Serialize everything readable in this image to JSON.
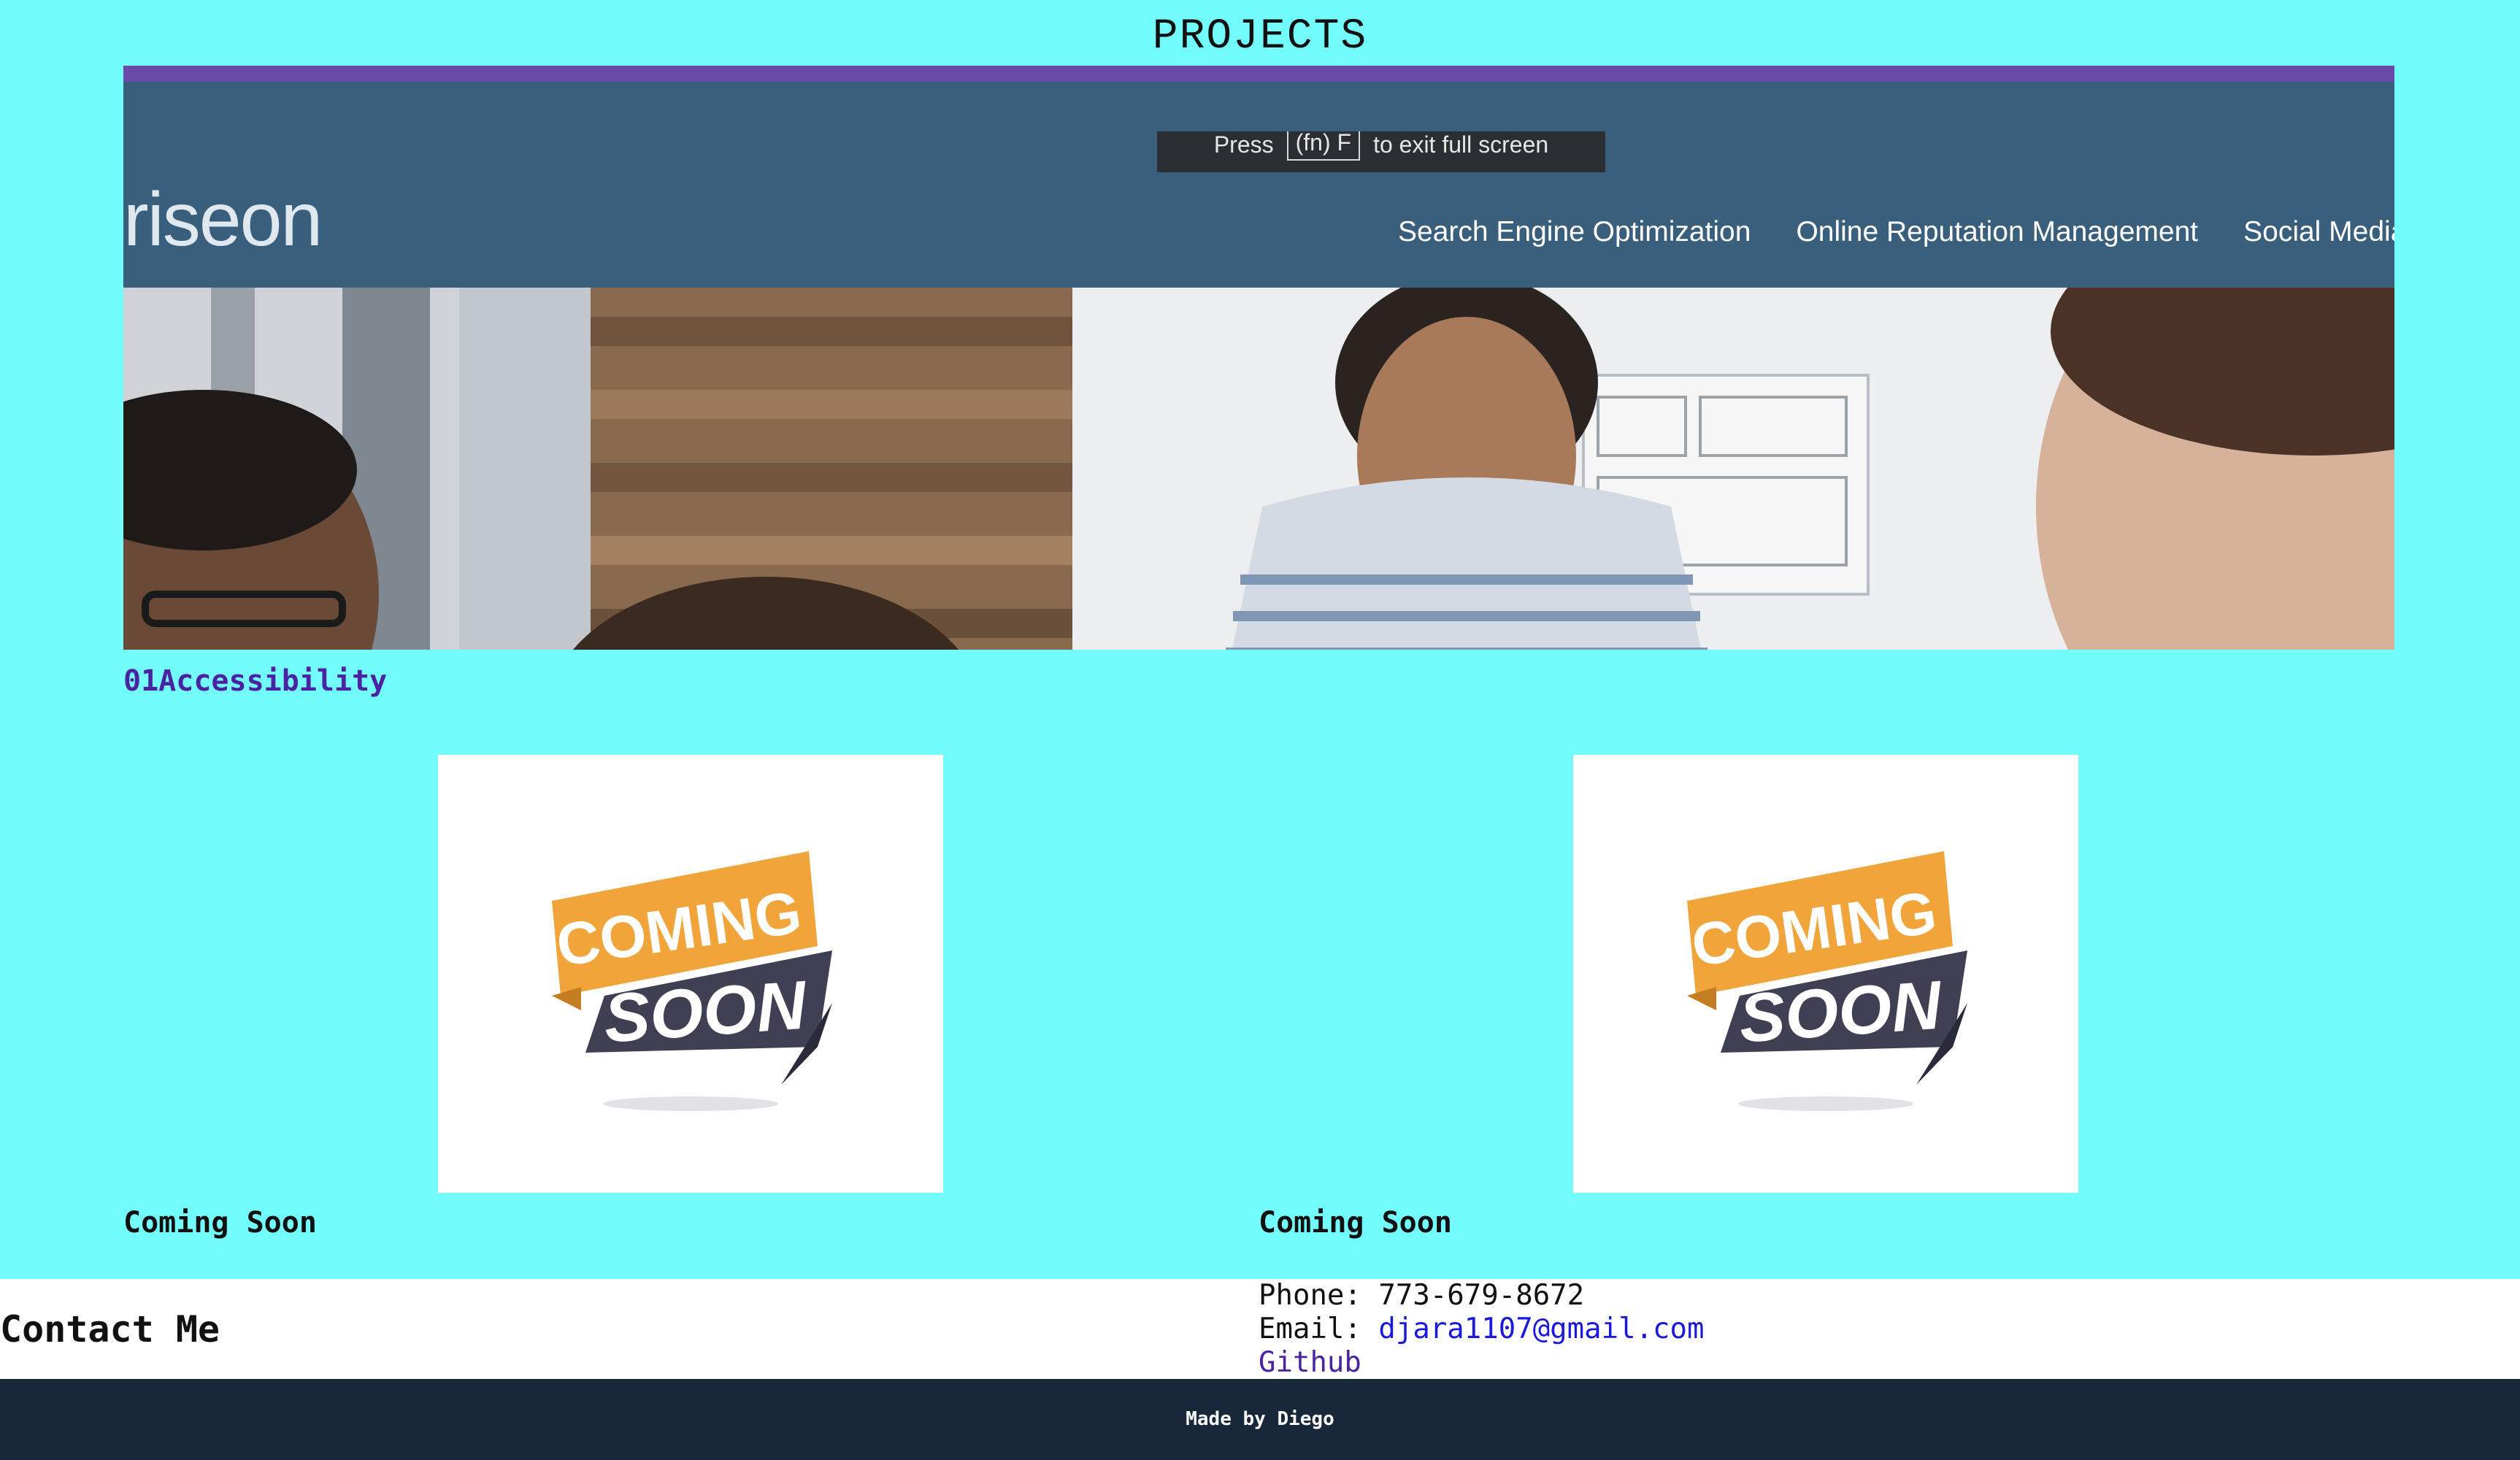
{
  "page": {
    "title": "PROJECTS"
  },
  "screenshot": {
    "logo": "riseon",
    "fullscreen_tip": {
      "before": "Press",
      "key": "(fn) F",
      "after": "to exit full screen"
    },
    "nav_links": [
      "Search Engine Optimization",
      "Online Reputation Management",
      "Social Media Mark"
    ]
  },
  "section": {
    "label": "01Accessibility"
  },
  "cards": [
    {
      "badge_top": "COMING",
      "badge_bottom": "SOON",
      "caption": "Coming Soon"
    },
    {
      "badge_top": "COMING",
      "badge_bottom": "SOON",
      "caption": "Coming Soon"
    }
  ],
  "contact": {
    "title": "Contact Me",
    "phone_label": "Phone:",
    "phone": "773-679-8672",
    "email_label": "Email:",
    "email": "djara1107@gmail.com",
    "github": "Github"
  },
  "footer": {
    "text": "Made by Diego"
  },
  "colors": {
    "background": "#73fcfc",
    "nav": "#3a5f7d",
    "accent_orange": "#f0a43a",
    "accent_dark": "#3f4054",
    "footer": "#18273a",
    "link": "#1a1ad8",
    "visited_link": "#4a23a3"
  }
}
